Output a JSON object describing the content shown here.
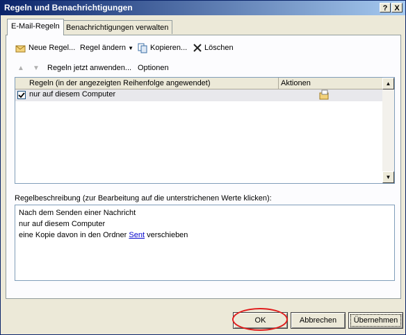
{
  "window": {
    "title": "Regeln und Benachrichtigungen",
    "help_label": "?",
    "close_label": "X"
  },
  "tabs": [
    {
      "label": "E-Mail-Regeln"
    },
    {
      "label": "Benachrichtigungen verwalten"
    }
  ],
  "toolbar": {
    "new_rule": "Neue Regel...",
    "change_rule": "Regel ändern",
    "copy": "Kopieren...",
    "delete": "Löschen",
    "apply_now": "Regeln jetzt anwenden...",
    "options": "Optionen"
  },
  "rules": {
    "columns": {
      "rules": "Regeln (in der angezeigten Reihenfolge angewendet)",
      "actions": "Aktionen"
    },
    "items": [
      {
        "name": "nur auf diesem Computer",
        "checked": true
      }
    ]
  },
  "description": {
    "label": "Regelbeschreibung (zur Bearbeitung auf die unterstrichenen Werte klicken):",
    "line1": "Nach dem Senden einer Nachricht",
    "line2": "nur auf diesem Computer",
    "line3_prefix": "eine Kopie davon in den Ordner",
    "line3_link": "Sent",
    "line3_suffix": "verschieben"
  },
  "buttons": {
    "ok": "OK",
    "cancel": "Abbrechen",
    "apply": "Übernehmen"
  },
  "colors": {
    "titlebar_start": "#0a246a",
    "highlight_ring": "#e01a1a",
    "link": "#0000cc"
  }
}
